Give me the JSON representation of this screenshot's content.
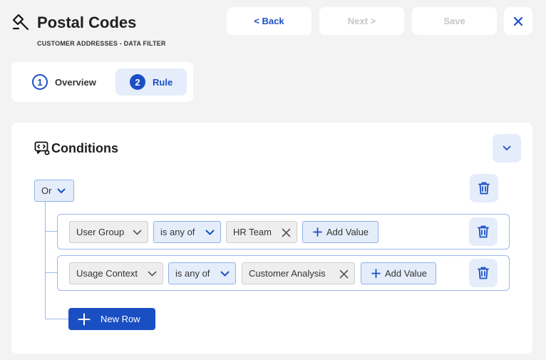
{
  "header": {
    "title": "Postal Codes",
    "subtitle": "CUSTOMER ADDRESSES - DATA FILTER",
    "back_label": "< Back",
    "next_label": "Next >",
    "save_label": "Save",
    "close_icon": "close-icon"
  },
  "steps": [
    {
      "number": "1",
      "label": "Overview",
      "active": false
    },
    {
      "number": "2",
      "label": "Rule",
      "active": true
    }
  ],
  "conditions": {
    "title": "Conditions",
    "operator": "Or",
    "rows": [
      {
        "field": "User Group",
        "comparator": "is any of",
        "values": [
          "HR Team"
        ],
        "add_value_label": "Add Value"
      },
      {
        "field": "Usage Context",
        "comparator": "is any of",
        "values": [
          "Customer Analysis"
        ],
        "add_value_label": "Add Value"
      }
    ],
    "new_row_label": "New Row"
  },
  "colors": {
    "accent": "#1a4fc4",
    "accent_light": "#e5edfb",
    "disabled_text": "#c6c6c6",
    "background": "#f3f3f3"
  }
}
